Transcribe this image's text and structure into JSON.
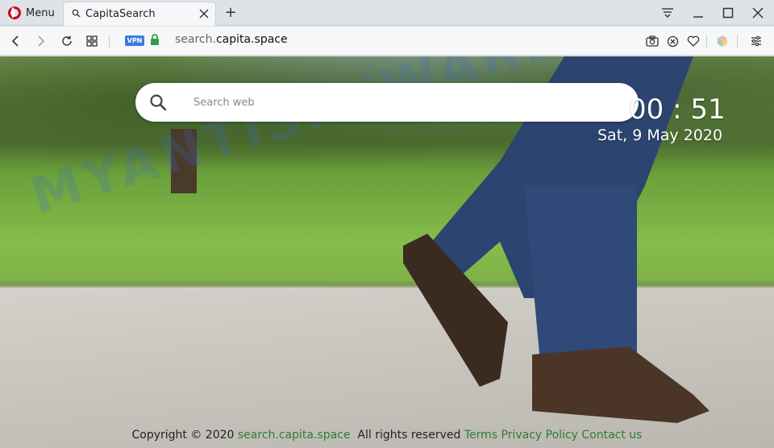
{
  "browser": {
    "menu_label": "Menu",
    "tab_title": "CapitaSearch",
    "new_tab_symbol": "+",
    "url_prefix": "search.",
    "url_domain": "capita.space",
    "vpn_label": "VPN"
  },
  "search": {
    "placeholder": "Search web"
  },
  "clock": {
    "time": "00 : 51",
    "date": "Sat, 9 May 2020"
  },
  "watermark": "MYANTISPYWARE.COM",
  "footer": {
    "copyright": "Copyright © 2020",
    "site_link": "search.capita.space",
    "rights": "All rights reserved",
    "terms": "Terms",
    "privacy": "Privacy Policy",
    "contact": "Contact us"
  },
  "colors": {
    "opera_red": "#d0021b",
    "vpn_blue": "#3d7be0",
    "lock_green": "#2ea043",
    "footer_link": "#2e7d32"
  }
}
